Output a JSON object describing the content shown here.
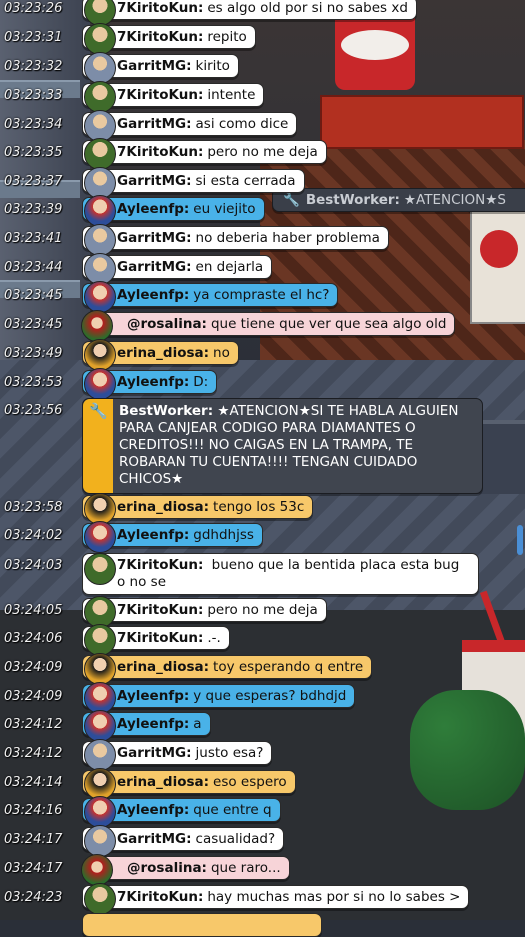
{
  "bestworker_banner": {
    "name": "BestWorker:",
    "message": "★ATENCION★S"
  },
  "messages": [
    {
      "time": "03:23:26",
      "user": "7KiritoKun:",
      "text": "es algo old por si no sabes xd"
    },
    {
      "time": "03:23:31",
      "user": "7KiritoKun:",
      "text": "repito"
    },
    {
      "time": "03:23:32",
      "user": "GarritMG:",
      "text": "kirito"
    },
    {
      "time": "03:23:33",
      "user": "7KiritoKun:",
      "text": "intente"
    },
    {
      "time": "03:23:34",
      "user": "GarritMG:",
      "text": "asi como dice"
    },
    {
      "time": "03:23:35",
      "user": "7KiritoKun:",
      "text": "pero no me deja"
    },
    {
      "time": "03:23:37",
      "user": "GarritMG:",
      "text": "si esta cerrada"
    },
    {
      "time": "03:23:39",
      "user": "Ayleenfp:",
      "text": "eu viejito"
    },
    {
      "time": "03:23:41",
      "user": "GarritMG:",
      "text": "no deberia haber problema"
    },
    {
      "time": "03:23:44",
      "user": "GarritMG:",
      "text": "en dejarla"
    },
    {
      "time": "03:23:45",
      "user": "Ayleenfp:",
      "text": "ya compraste el hc?"
    },
    {
      "time": "03:23:45",
      "user": "@rosalina:",
      "text": "que tiene que ver que sea algo old"
    },
    {
      "time": "03:23:49",
      "user": "erina_diosa:",
      "text": "no"
    },
    {
      "time": "03:23:53",
      "user": "Ayleenfp:",
      "text": "D:"
    },
    {
      "time": "03:23:56",
      "user": "BestWorker:",
      "text": "★ATENCION★SI TE HABLA ALGUIEN PARA CANJEAR CODIGO PARA DIAMANTES O CREDITOS!!! NO CAIGAS EN LA TRAMPA, TE ROBARAN TU CUENTA!!!! TENGAN CUIDADO CHICOS★"
    },
    {
      "time": "03:23:58",
      "user": "erina_diosa:",
      "text": "tengo los 53c"
    },
    {
      "time": "03:24:02",
      "user": "Ayleenfp:",
      "text": "gdhdhjss"
    },
    {
      "time": "03:24:03",
      "user": "7KiritoKun:",
      "text": "bueno que la bentida placa esta bug o no se"
    },
    {
      "time": "03:24:05",
      "user": "7KiritoKun:",
      "text": "pero no me deja"
    },
    {
      "time": "03:24:06",
      "user": "7KiritoKun:",
      "text": ".-."
    },
    {
      "time": "03:24:09",
      "user": "erina_diosa:",
      "text": "toy esperando q entre"
    },
    {
      "time": "03:24:09",
      "user": "Ayleenfp:",
      "text": "y que esperas? bdhdjd"
    },
    {
      "time": "03:24:12",
      "user": "Ayleenfp:",
      "text": "a"
    },
    {
      "time": "03:24:12",
      "user": "GarritMG:",
      "text": "justo esa?"
    },
    {
      "time": "03:24:14",
      "user": "erina_diosa:",
      "text": "eso espero"
    },
    {
      "time": "03:24:16",
      "user": "Ayleenfp:",
      "text": "que entre q"
    },
    {
      "time": "03:24:17",
      "user": "GarritMG:",
      "text": "casualidad?"
    },
    {
      "time": "03:24:17",
      "user": "@rosalina:",
      "text": "que raro..."
    },
    {
      "time": "03:24:23",
      "user": "7KiritoKun:",
      "text": "hay muchas mas por si no lo sabes >"
    }
  ],
  "colors": {
    "white_bubble": "#ffffff",
    "blue_bubble": "#49b2e8",
    "orange_bubble": "#f7c86a",
    "pink_bubble": "#f7d4d8",
    "dark_bubble": "#40454f",
    "bestworker_bar": "#f2b11d"
  },
  "icons": {
    "bestworker": "wrench-icon",
    "users": "habbo-avatar-icon"
  }
}
